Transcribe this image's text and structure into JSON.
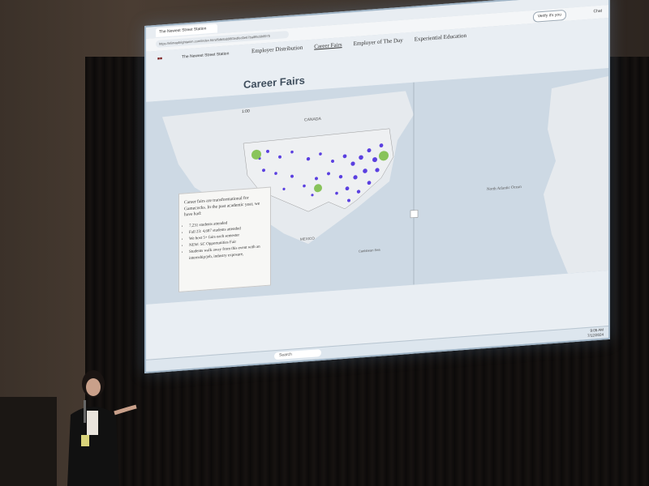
{
  "browser": {
    "tab_title": "The Newest Street Station",
    "url": "https://elimapbrightanim.com/index.html/6db8ab98f3edfed3e67ba8f6c6b897b",
    "profile_label": "Verify it's you",
    "chat_label": "Chat"
  },
  "site": {
    "brand": "The Newest Street Station",
    "nav": [
      "Employer Distribution",
      "Career Fairs",
      "Employer of The Day",
      "Experiential Education"
    ],
    "active_nav_index": 1,
    "page_title": "Career Fairs"
  },
  "map": {
    "labels": {
      "canada": "CANADA",
      "mexico": "MEXICO",
      "caribbean": "Caribbean Sea",
      "atlantic": "North Atlantic Ocean",
      "pacific_corner": "1:00"
    },
    "colors": {
      "points": "#5a3fe0",
      "highlight": "#7dbf4a",
      "land": "#e6eaee",
      "water": "#cdd9e4"
    }
  },
  "card": {
    "intro": "Career fairs are transformational for Gamecocks. In the past academic year, we have had:",
    "items": [
      "7,231 students attended",
      "Fall 23: 4,687 students attended",
      "We host 5+ fairs each semester",
      "NEW: SC Opportunities Fair",
      "Students walk away from this event with an internship/job, industry exposure,"
    ]
  },
  "taskbar": {
    "search": "Search",
    "time": "9:05 AM",
    "date": "7/12/2024"
  }
}
